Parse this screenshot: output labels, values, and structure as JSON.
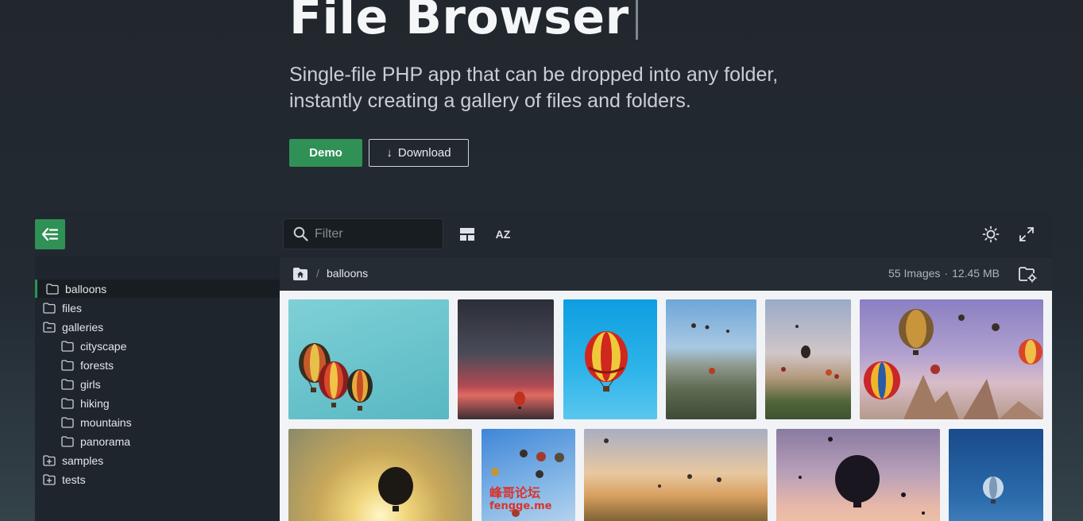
{
  "hero": {
    "title": "File Browser",
    "subtitle_line1": "Single-file PHP app that can be dropped into any folder,",
    "subtitle_line2": "instantly creating a gallery of files and folders.",
    "demo_label": "Demo",
    "download_label": "Download",
    "download_arrow": "↓"
  },
  "colors": {
    "accent": "#2f9155",
    "bg": "#222a32",
    "panel": "#1f252c"
  },
  "toolbar": {
    "filter_placeholder": "Filter",
    "sort_label": "AZ",
    "icons": [
      "back-menu-icon",
      "search-icon",
      "layout-icon",
      "sort-az-icon",
      "brightness-icon",
      "fullscreen-icon"
    ]
  },
  "sidebar": {
    "items": [
      {
        "label": "balloons",
        "icon": "folder-icon",
        "active": true
      },
      {
        "label": "files",
        "icon": "folder-icon"
      },
      {
        "label": "galleries",
        "icon": "collapse-icon"
      },
      {
        "label": "cityscape",
        "icon": "folder-icon"
      },
      {
        "label": "forests",
        "icon": "folder-icon"
      },
      {
        "label": "girls",
        "icon": "folder-icon"
      },
      {
        "label": "hiking",
        "icon": "folder-icon"
      },
      {
        "label": "mountains",
        "icon": "folder-icon"
      },
      {
        "label": "panorama",
        "icon": "folder-icon"
      },
      {
        "label": "samples",
        "icon": "expand-icon"
      },
      {
        "label": "tests",
        "icon": "expand-icon"
      }
    ]
  },
  "breadcrumb": {
    "separator": "/",
    "folder": "balloons"
  },
  "folder_info": {
    "count": "55 Images",
    "dot": "·",
    "size": "12.45 MB"
  },
  "watermark": {
    "line1": "峰哥论坛",
    "line2": "fengge.me"
  }
}
